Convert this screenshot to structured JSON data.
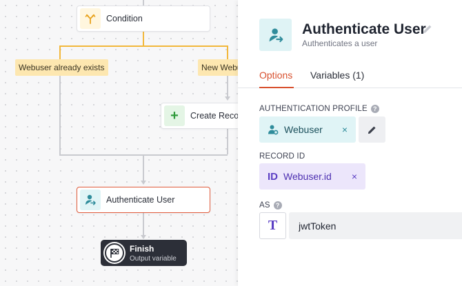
{
  "canvas": {
    "condition_node": {
      "label": "Condition"
    },
    "branches": [
      {
        "label": "Webuser already exists"
      },
      {
        "label": "New Webuser"
      }
    ],
    "create_record_node": {
      "label": "Create Record"
    },
    "authenticate_node": {
      "label": "Authenticate User"
    },
    "finish_node": {
      "title": "Finish",
      "subtitle": "Output variable"
    }
  },
  "panel": {
    "title": "Authenticate User",
    "subtitle": "Authenticates a user",
    "tabs": [
      {
        "label": "Options",
        "active": true
      },
      {
        "label": "Variables (1)",
        "active": false
      }
    ],
    "auth_profile": {
      "label": "AUTHENTICATION PROFILE",
      "value": "Webuser",
      "remove": "×"
    },
    "record_id": {
      "label": "RECORD ID",
      "badge": "ID",
      "value": "Webuser.id",
      "remove": "×"
    },
    "as_field": {
      "label": "AS",
      "type_glyph": "T",
      "value": "jwtToken"
    },
    "help_glyph": "?"
  },
  "colors": {
    "accent": "#d8502e",
    "teal": "#2f8c9b",
    "purple": "#5b3fc4",
    "branch": "#fde7b0",
    "connector_orange": "#f2b73a"
  },
  "icons": {
    "condition": "branch-fork-icon",
    "create": "plus-icon",
    "authenticate": "user-login-icon",
    "finish": "checkered-flag-icon",
    "edit": "pencil-icon",
    "close": "close-icon"
  }
}
